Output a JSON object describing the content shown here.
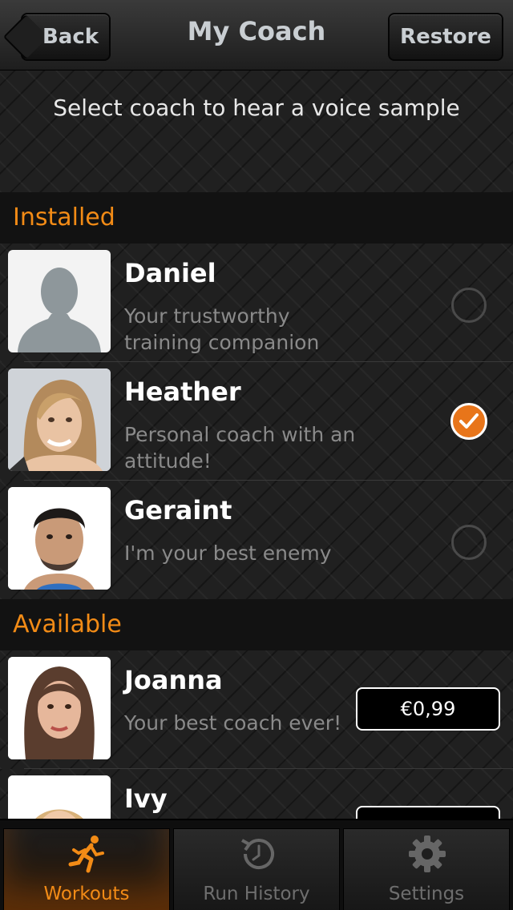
{
  "nav": {
    "title": "My Coach",
    "back_label": "Back",
    "restore_label": "Restore"
  },
  "subtitle": "Select coach to hear a voice sample",
  "sections": {
    "installed": "Installed",
    "available": "Available"
  },
  "installed_coaches": [
    {
      "name": "Daniel",
      "description": "Your trustworthy training companion",
      "selected": false
    },
    {
      "name": "Heather",
      "description": "Personal coach with an attitude!",
      "selected": true
    },
    {
      "name": "Geraint",
      "description": "I'm your best enemy",
      "selected": false
    }
  ],
  "available_coaches": [
    {
      "name": "Joanna",
      "description": "Your best coach ever!",
      "price": "€0,99"
    },
    {
      "name": "Ivy",
      "description": "",
      "price": ""
    }
  ],
  "tabs": [
    {
      "label": "Workouts",
      "icon": "runner-icon",
      "active": true
    },
    {
      "label": "Run History",
      "icon": "history-clock-icon",
      "active": false
    },
    {
      "label": "Settings",
      "icon": "gear-icon",
      "active": false
    }
  ],
  "colors": {
    "accent": "#f28b16",
    "checked": "#e8751a"
  }
}
